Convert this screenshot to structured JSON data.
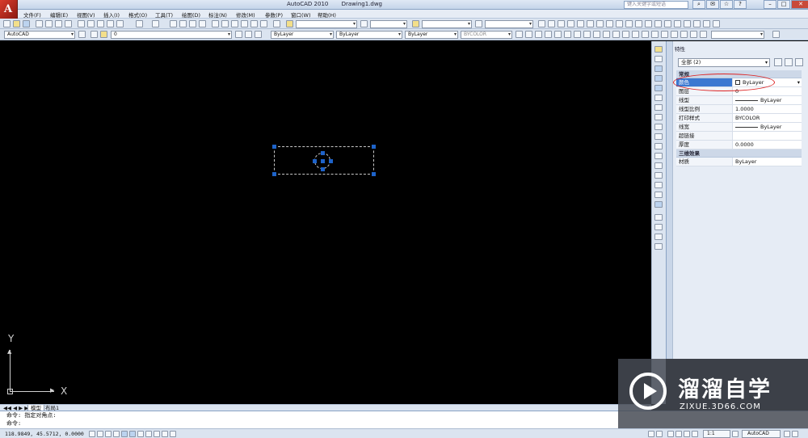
{
  "titlebar": {
    "app_name": "AutoCAD 2010",
    "document": "Drawing1.dwg",
    "search_placeholder": "键入关键字或短语"
  },
  "menu": [
    "文件(F)",
    "编辑(E)",
    "视图(V)",
    "插入(I)",
    "格式(O)",
    "工具(T)",
    "绘图(D)",
    "标注(N)",
    "修改(M)",
    "参数(P)",
    "窗口(W)",
    "帮助(H)"
  ],
  "toolbar": {
    "workspace": "AutoCAD",
    "layer_value": "0",
    "color_value": "ByLayer",
    "linetype_value": "ByLayer",
    "lineweight_value": "ByLayer",
    "plotstyle_value": "BYCOLOR"
  },
  "tabs": {
    "model": "模型",
    "layout1": "布局1"
  },
  "command": {
    "line1": "命令: 指定对角点:",
    "line2": "命令:"
  },
  "status": {
    "coords": "118.9849, 45.5712, 0.0000",
    "scale": "1:1",
    "workspace": "AutoCAD"
  },
  "properties": {
    "title": "特性",
    "selection": "全部 (2)",
    "general_header": "常规",
    "rows": [
      {
        "key": "颜色",
        "value": "ByLayer"
      },
      {
        "key": "图层",
        "value": "0"
      },
      {
        "key": "线型",
        "value": "ByLayer"
      },
      {
        "key": "线型比例",
        "value": "1.0000"
      },
      {
        "key": "打印样式",
        "value": "BYCOLOR"
      },
      {
        "key": "线宽",
        "value": "ByLayer"
      },
      {
        "key": "超链接",
        "value": ""
      },
      {
        "key": "厚度",
        "value": "0.0000"
      }
    ],
    "3d_header": "三维效果",
    "rows3d": [
      {
        "key": "材质",
        "value": "ByLayer"
      }
    ]
  },
  "ucs": {
    "x_label": "X",
    "y_label": "Y"
  },
  "watermark": {
    "cn": "溜溜自学",
    "url": "ZIXUE.3D66.COM"
  }
}
